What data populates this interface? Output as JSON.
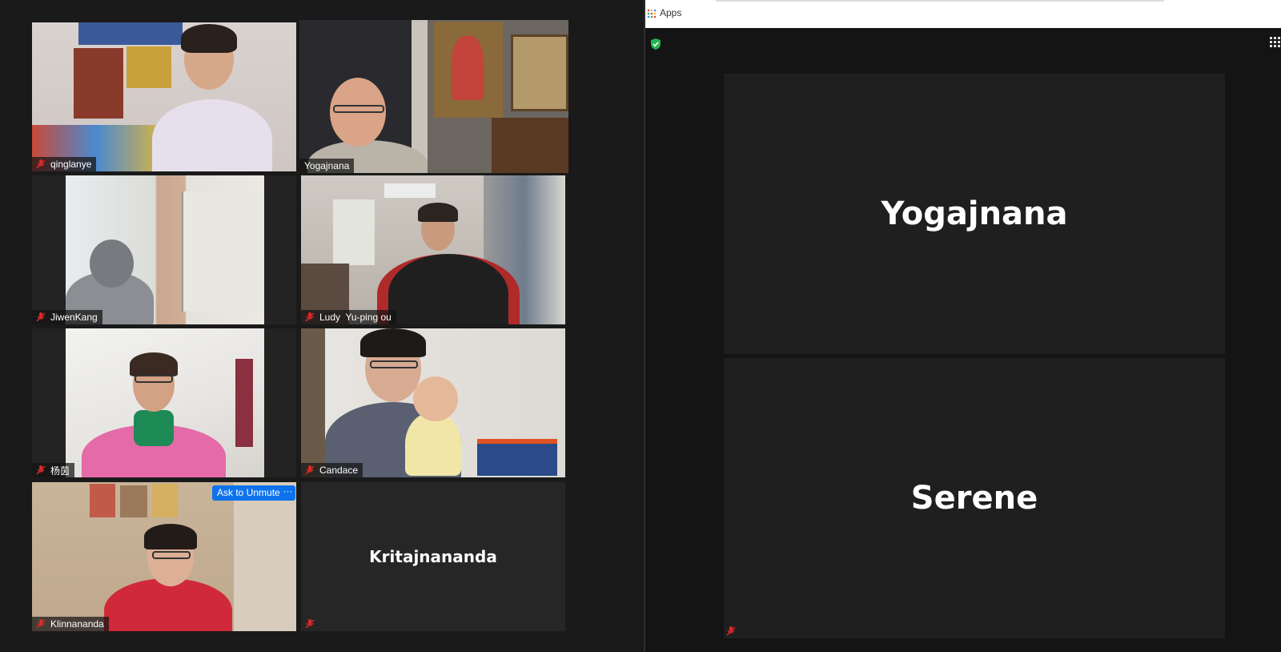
{
  "gallery": {
    "tiles": [
      {
        "name": "qinglanye"
      },
      {
        "name": "Yogajnana"
      },
      {
        "name": "JiwenKang"
      },
      {
        "name": "Ludy  Yu-ping ou"
      },
      {
        "name": "杨茵"
      },
      {
        "name": "Candace"
      },
      {
        "name": "Klinnananda",
        "ask_to_unmute": "Ask to Unmute",
        "more": "···"
      },
      {
        "name": "Kritajnananda"
      }
    ]
  },
  "browser": {
    "apps_label": "Apps"
  },
  "speaker_view": {
    "tiles": [
      {
        "name": "Yogajnana"
      },
      {
        "name": "Serene"
      }
    ]
  },
  "colors": {
    "active_speaker_border": "#c9df5a",
    "button_blue": "#0e72ed",
    "mic_muted": "#e02828",
    "shield_green": "#23b34d"
  },
  "icons": [
    "mic-muted-icon",
    "shield-icon",
    "apps-grid-icon",
    "grid-view-icon",
    "more-icon"
  ]
}
